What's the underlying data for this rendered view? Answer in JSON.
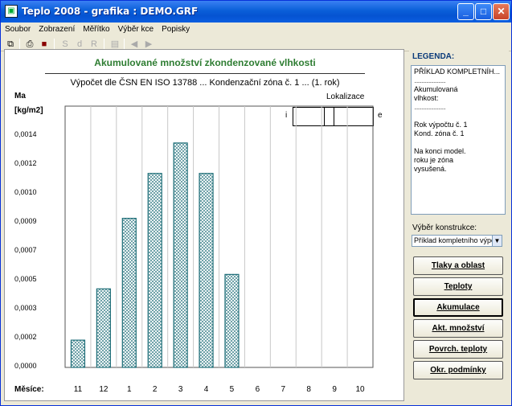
{
  "window": {
    "title": "Teplo 2008 - grafika : DEMO.GRF",
    "buttons": {
      "minimize": "_",
      "maximize": "□",
      "close": "✕"
    }
  },
  "menu": [
    "Soubor",
    "Zobrazení",
    "Měřítko",
    "Výběr kce",
    "Popisky"
  ],
  "toolbar": {
    "icons": [
      "copy-icon",
      "print-icon",
      "save-icon",
      "S-icon",
      "d-icon",
      "R-icon",
      "export-icon",
      "prev-icon",
      "next-icon"
    ],
    "letters": {
      "s": "S",
      "d": "d",
      "r": "R"
    }
  },
  "chart": {
    "lokalizace_label": "Lokalizace",
    "lokal_i": "i",
    "lokal_e": "e",
    "unit_line1": "Ma",
    "unit_line2": "[kg/m2]",
    "x_axis_caption": "Měsíce:"
  },
  "chart_data": {
    "type": "bar",
    "title": "Akumulované množství zkondenzované vlhkosti",
    "subtitle": "Výpočet dle ČSN EN ISO 13788 ... Kondenzační zóna č. 1 ... (1. rok)",
    "xlabel": "Měsíce:",
    "ylabel": "Ma [kg/m2]",
    "categories": [
      "11",
      "12",
      "1",
      "2",
      "3",
      "4",
      "5",
      "6",
      "7",
      "8",
      "9",
      "10"
    ],
    "values": [
      0.00017,
      0.00049,
      0.00093,
      0.00121,
      0.0014,
      0.00121,
      0.00058,
      0,
      0,
      0,
      0,
      0
    ],
    "yticks": [
      "0,0014",
      "0,0012",
      "0,0010",
      "0,0009",
      "0,0007",
      "0,0005",
      "0,0003",
      "0,0002",
      "0,0000"
    ],
    "ylim": [
      0,
      0.00163
    ],
    "grid": "vertical",
    "bar_fill": "hatched",
    "bar_color": "#1e6e78"
  },
  "legend": {
    "header": "LEGENDA:",
    "lines": [
      "PŘÍKLAD KOMPLETNÍH...",
      "..........................",
      "Akumulovaná",
      "vlhkost:",
      "..........................",
      "",
      "Rok výpočtu č. 1",
      "Kond. zóna č. 1",
      "",
      "Na konci model.",
      "roku je zóna",
      "vysušená."
    ]
  },
  "selector": {
    "label": "Výběr konstrukce:",
    "value": "Příklad kompletního výpoč"
  },
  "buttons": [
    {
      "label": "Tlaky a oblast",
      "active": false
    },
    {
      "label": "Teploty",
      "active": false
    },
    {
      "label": "Akumulace",
      "active": true
    },
    {
      "label": "Akt. množství",
      "active": false
    },
    {
      "label": "Povrch. teploty",
      "active": false
    },
    {
      "label": "Okr. podmínky",
      "active": false
    }
  ]
}
